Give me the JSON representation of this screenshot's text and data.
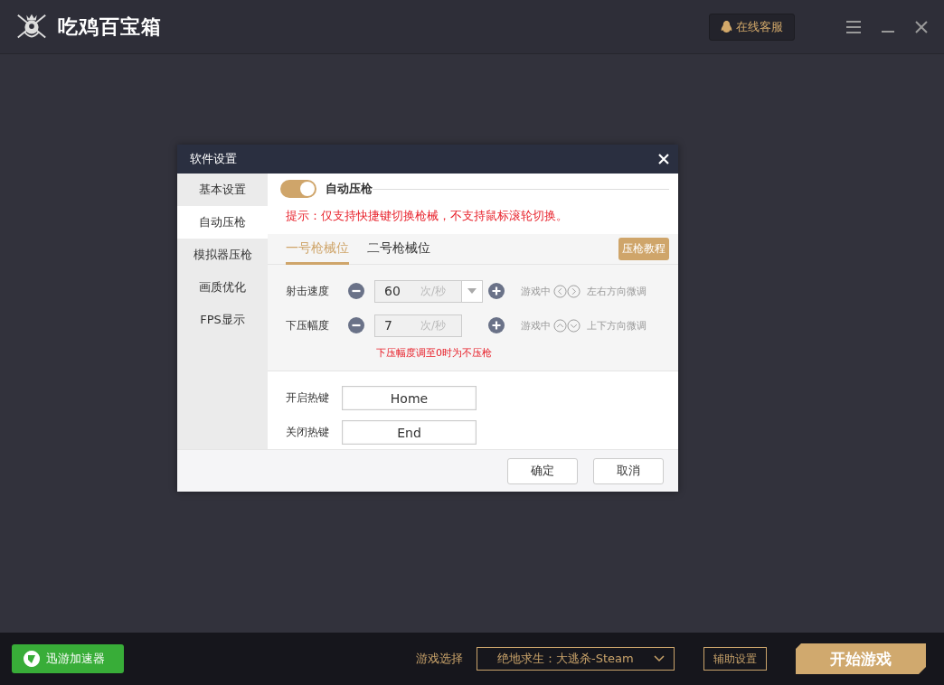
{
  "app": {
    "title": "吃鸡百宝箱",
    "support_button": "在线客服"
  },
  "dialog": {
    "title": "软件设置",
    "sidebar": [
      {
        "label": "基本设置",
        "selected": false
      },
      {
        "label": "自动压枪",
        "selected": true
      },
      {
        "label": "模拟器压枪",
        "selected": false
      },
      {
        "label": "画质优化",
        "selected": false
      },
      {
        "label": "FPS显示",
        "selected": false
      }
    ],
    "toggle": {
      "label": "自动压枪",
      "on": true
    },
    "hint": "提示：仅支持快捷键切换枪械，不支持鼠标滚轮切换。",
    "tabs": [
      {
        "label": "一号枪械位",
        "selected": true
      },
      {
        "label": "二号枪械位",
        "selected": false
      }
    ],
    "tutorial_button": "压枪教程",
    "settings": [
      {
        "kind": "dropdown",
        "label": "射击速度",
        "value": "60",
        "unit": "次/秒",
        "hint_prefix": "游戏中",
        "hint_suffix": "左右方向微调"
      },
      {
        "kind": "stepper",
        "label": "下压幅度",
        "value": "7",
        "unit": "次/秒",
        "hint_prefix": "游戏中",
        "hint_suffix": "上下方向微调"
      }
    ],
    "note": "下压幅度调至0时为不压枪",
    "hotkeys": [
      {
        "label": "开启热键",
        "value": "Home"
      },
      {
        "label": "关闭热键",
        "value": "End"
      }
    ],
    "buttons": [
      "确定",
      "取消"
    ]
  },
  "bottom": {
    "accelerator_button": "迅游加速器",
    "game_label": "游戏选择",
    "game_select": "绝地求生：大逃杀-Steam",
    "assist_button": "辅助设置",
    "start_button": "开始游戏"
  }
}
